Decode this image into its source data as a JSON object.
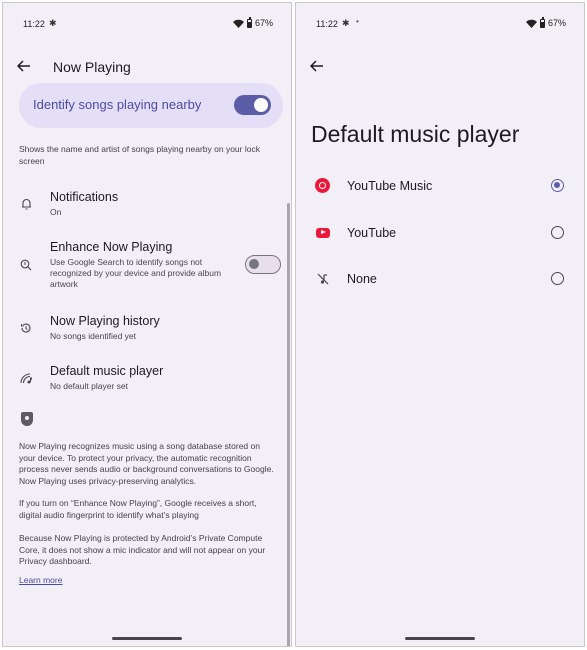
{
  "status_left": {
    "time": "11:22",
    "battery": "67%"
  },
  "status_right": {
    "time": "11:22",
    "battery": "67%"
  },
  "left": {
    "title": "Now Playing",
    "identify": {
      "label": "Identify songs playing nearby",
      "on": true
    },
    "identify_desc": "Shows the name and artist of songs playing nearby on your lock screen",
    "rows": [
      {
        "title": "Notifications",
        "subtitle": "On",
        "icon": "bell-icon"
      },
      {
        "title": "Enhance Now Playing",
        "subtitle": "Use Google Search to identify songs not recognized by your device and provide album artwork",
        "icon": "search-music-icon",
        "toggle": false
      },
      {
        "title": "Now Playing history",
        "subtitle": "No songs identified yet",
        "icon": "history-icon"
      },
      {
        "title": "Default music player",
        "subtitle": "No default player set",
        "icon": "music-player-icon"
      }
    ],
    "privacy_paragraphs": [
      "Now Playing recognizes music using a song database stored on your device. To protect your privacy, the automatic recognition process never sends audio or background conversations to Google. Now Playing uses privacy-preserving analytics.",
      "If you turn on “Enhance Now Playing”, Google receives a short, digital audio fingerprint to identify what’s playing",
      "Because Now Playing is protected by Android’s Private Compute Core, it does not show a mic indicator and will not appear on your Privacy dashboard."
    ],
    "learn_more": "Learn more"
  },
  "right": {
    "title": "Default music player",
    "options": [
      {
        "label": "YouTube Music",
        "selected": true
      },
      {
        "label": "YouTube",
        "selected": false
      },
      {
        "label": "None",
        "selected": false
      }
    ]
  },
  "colors": {
    "accent": "#5b5ea6",
    "card": "#e4dff7",
    "background": "#f3eff6",
    "youtube_red": "#e8193a"
  }
}
